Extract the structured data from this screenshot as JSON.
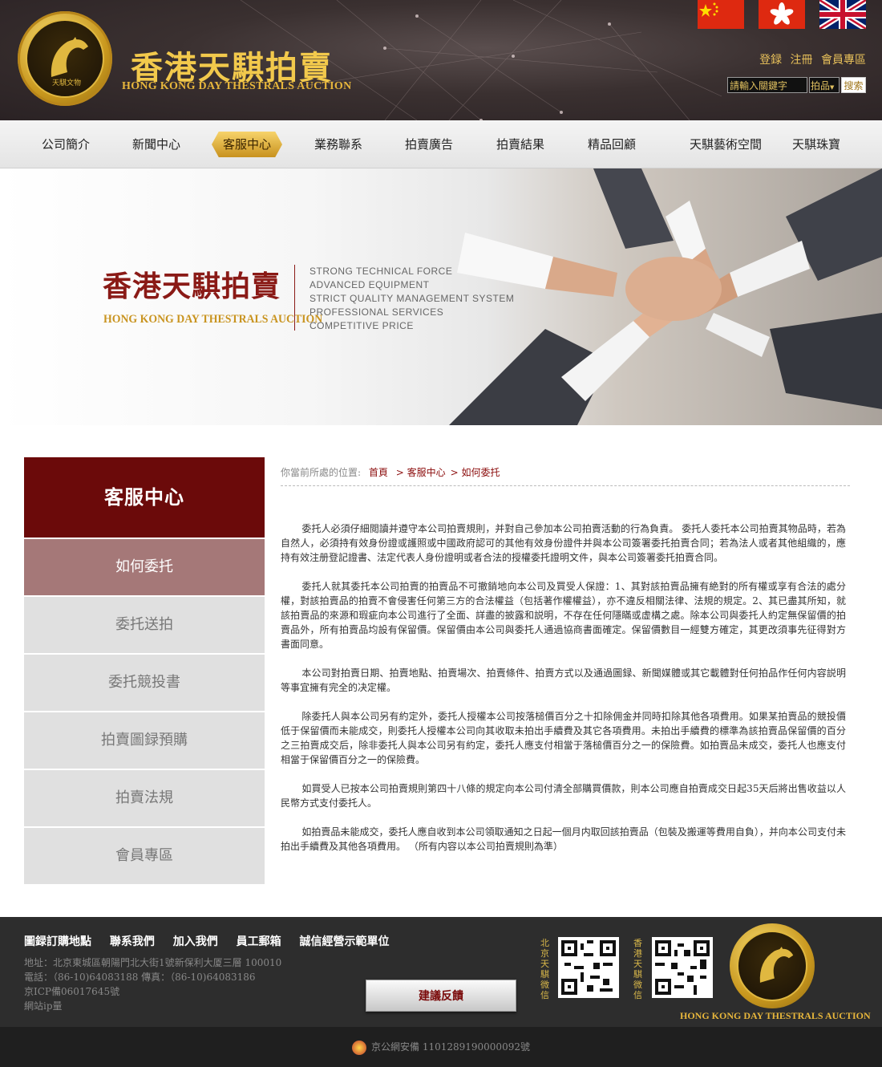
{
  "header": {
    "brand_cn": "香港天騏拍賣",
    "brand_en": "HONG KONG DAY THESTRALS AUCTION",
    "coin_text": "天騏文物",
    "top_links": [
      "登録",
      "注冊",
      "會員專區"
    ],
    "search": {
      "placeholder": "請輸入關鍵字",
      "category": "拍品",
      "button": "搜索"
    }
  },
  "nav": [
    "公司簡介",
    "新聞中心",
    "客服中心",
    "業務聯系",
    "拍賣廣告",
    "拍賣結果",
    "精品回顧",
    "天騏藝術空間",
    "天騏珠寶"
  ],
  "banner": {
    "title_cn": "香港天騏拍賣",
    "title_en": "HONG KONG DAY THESTRALS AUCTION",
    "lines": [
      "STRONG TECHNICAL FORCE",
      "ADVANCED EQUIPMENT",
      "STRICT QUALITY MANAGEMENT SYSTEM",
      "PROFESSIONAL SERVICES",
      "COMPETITIVE PRICE"
    ]
  },
  "sidebar": {
    "heading": "客服中心",
    "items": [
      "如何委托",
      "委托送拍",
      "委托競投書",
      "拍賣圖録預購",
      "拍賣法規",
      "會員專區"
    ]
  },
  "breadcrumb": {
    "prefix": "你當前所處的位置:",
    "home": "首頁",
    "section": "> 客服中心",
    "page": "> 如何委托"
  },
  "article": [
    "委托人必須仔細閲讀并遵守本公司拍賣規則，并對自己參加本公司拍賣活動的行為負責。 委托人委托本公司拍賣其物品時，若為自然人，必須持有效身份證或護照或中國政府認可的其他有效身份證件并與本公司簽署委托拍賣合同；若為法人或者其他組織的，應持有效注册登記證書、法定代表人身份證明或者合法的授權委托證明文件，與本公司簽署委托拍賣合同。",
    "委托人就其委托本公司拍賣的拍賣品不可撤銷地向本公司及買受人保證：1、其對該拍賣品擁有絶對的所有權或享有合法的處分權，對該拍賣品的拍賣不會侵害任何第三方的合法權益（包括著作權權益），亦不違反相關法律、法規的規定。2、其已盡其所知，就該拍賣品的來源和瑕疵向本公司進行了全面、詳盡的披露和説明，不存在任何隱瞞或虚構之處。除本公司與委托人約定無保留價的拍賣品外，所有拍賣品均設有保留價。保留價由本公司與委托人通過協商書面確定。保留價數目一經雙方確定，其更改須事先征得對方書面同意。",
    "本公司對拍賣日期、拍賣地點、拍賣場次、拍賣條件、拍賣方式以及通過圖録、新聞媒體或其它載體對任何拍品作任何内容説明等事宜擁有完全的决定權。",
    "除委托人與本公司另有約定外，委托人授權本公司按落槌價百分之十扣除佣金并同時扣除其他各項費用。如果某拍賣品的競投價低于保留價而未能成交，則委托人授權本公司向其收取未拍出手續費及其它各項費用。未拍出手續費的標準為該拍賣品保留價的百分之三拍賣成交后，除非委托人與本公司另有約定，委托人應支付相當于落槌價百分之一的保險費。如拍賣品未成交，委托人也應支付相當于保留價百分之一的保險費。",
    "如買受人已按本公司拍賣規則第四十八條的規定向本公司付清全部購買價款，則本公司應自拍賣成交日起35天后將出售收益以人民幣方式支付委托人。",
    "如拍賣品未能成交，委托人應自收到本公司領取通知之日起一個月内取回該拍賣品（包裝及搬運等費用自負），并向本公司支付未拍出手續費及其他各項費用。 （所有内容以本公司拍賣規則為準）"
  ],
  "footer": {
    "links": [
      "圖録訂購地點",
      "聯系我們",
      "加入我們",
      "員工郵箱",
      "誠信經營示範單位"
    ],
    "address": "地址：北京東城區朝陽門北大街1號新保利大厦三層 100010",
    "phone": "電話：（86-10)64083188 傳真：（86-10)64083186",
    "icp": "京ICP備06017645號",
    "ip": "網站ip量",
    "feedback": "建議反饋",
    "qr1_label": "北京天騏微信",
    "qr2_label": "香港天騏微信",
    "brand_en": "HONG KONG DAY THESTRALS AUCTION"
  },
  "bottom": {
    "police": "京公網安備 110128919000009​2號"
  },
  "colors": {
    "maroon": "#6b0a0a",
    "gold": "#e7b63c",
    "sidebar_active": "#a57878"
  }
}
